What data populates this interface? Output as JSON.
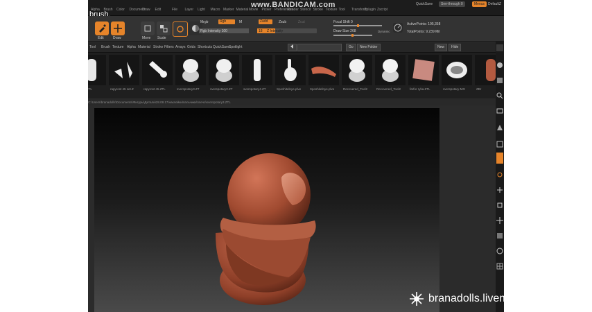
{
  "doc_title": "brush.",
  "watermark_top": "www.BANDICAM.com",
  "menu_items": [
    "Alpha",
    "Brush",
    "Color",
    "Document",
    "Draw",
    "Edit",
    "File",
    "Layer",
    "Light",
    "Macro",
    "Marker",
    "Material",
    "Movie",
    "Picker",
    "Preferences",
    "Render",
    "Stencil",
    "Stroke",
    "Texture",
    "Tool",
    "Transform",
    "Zplugin",
    "Zscript"
  ],
  "top_right": {
    "quicksave": "QuickSave",
    "see_through": "See-through 0",
    "menus": "Menus",
    "default": "DefaultZ"
  },
  "toolbar": {
    "edit_label": "Edit",
    "draw_label": "Draw",
    "move_label": "Move",
    "scale_label": "Scale",
    "rotate_label": "Rotate",
    "mrgb": "Mrgb",
    "rgb": "Rgb",
    "m": "M",
    "rgb_intensity": "Rgb Intensity 100",
    "zadd": "Zadd",
    "zsub": "Zsub",
    "zcut": "Zcut",
    "z_intensity": "Z Intensity",
    "z_intensity_value": "18",
    "focal_shift": "Focal Shift 0",
    "draw_size": "Draw Size 268",
    "dynamic": "Dynamic",
    "active_points": "ActivePoints: 195,358",
    "total_points": "TotalPoints: 9.239 Mil"
  },
  "brush_menus": [
    "Tool",
    "Brush",
    "Texture",
    "Alpha",
    "Material",
    "Stroke",
    "Filters",
    "Arrays",
    "Grids",
    "Shortcuts",
    "QuickSave",
    "Spotlight"
  ],
  "brush_buttons": {
    "go": "Go",
    "new_folder": "New Folder",
    "new": "New",
    "hide": "Hide"
  },
  "thumbnails": [
    {
      "caption": "sheniy.ZTL",
      "color": "#e8e8e8",
      "shape": "partial"
    },
    {
      "caption": "rapyrost 45 set.Z",
      "color": "#f0f0f0",
      "shape": "hands"
    },
    {
      "caption": "rapyrost 45.ZTL",
      "color": "#f2f2f2",
      "shape": "finger"
    },
    {
      "caption": "sverspotary3.ZT",
      "color": "#f0f0f0",
      "shape": "bulb"
    },
    {
      "caption": "sverspotary2.ZT",
      "color": "#f0f0f0",
      "shape": "bulb"
    },
    {
      "caption": "sverspotary4.ZT",
      "color": "#f0f0f0",
      "shape": "tube"
    },
    {
      "caption": "Sposhitelnye.plve",
      "color": "#f0f0f0",
      "shape": "hand"
    },
    {
      "caption": "Sposhitelnye.plve",
      "color": "#c8664a",
      "shape": "arm"
    },
    {
      "caption": "Recovered_Tool2",
      "color": "#f2f2f2",
      "shape": "bulb"
    },
    {
      "caption": "Recovered_Tool2",
      "color": "#f2f2f2",
      "shape": "bulb2"
    },
    {
      "caption": "farfor ryka.ZTL",
      "color": "#c98a80",
      "shape": "square"
    },
    {
      "caption": "sverspotary-MG",
      "color": "#eeeeee",
      "shape": "head"
    },
    {
      "caption": "ZBr",
      "color": "#b35a40",
      "shape": "partial"
    }
  ],
  "path_text": "C:\\Users\\branadolls\\Documents\\Фигуры\\Детали\\28.08.17\\наклейки\\пальчики\\плечо\\sverspotary3.ZTL",
  "bottom_watermark": "branadolls.livemaster.ru",
  "colors": {
    "accent": "#e6842a",
    "clay": "#b45a3e",
    "bg": "#2b2b2b"
  }
}
